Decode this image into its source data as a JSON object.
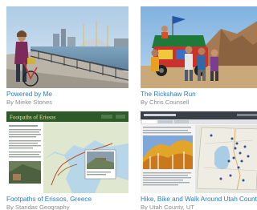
{
  "gallery": {
    "items": [
      {
        "title": "Powered by Me",
        "author": "By Mieke Stones",
        "thumbnail": "photo of a woman with bicycle on a waterfront promenade, city skyline behind"
      },
      {
        "title": "The Rickshaw Run",
        "author": "By Chris Counsell",
        "thumbnail": "photo of travelers posing with a decorated rickshaw in a desert"
      },
      {
        "title": "Footpaths of Erissos, Greece",
        "author": "By Staridas Geography",
        "thumbnail": "story map screenshot with green header, text panel and coastal map",
        "map_header": "Footpaths of Erissos"
      },
      {
        "title": "Hike, Bike and Walk Around Utah County",
        "author": "By Utah County, UT",
        "thumbnail": "story map screenshot with autumn aspen photo and county map"
      }
    ]
  },
  "colors": {
    "title_link": "#2a7bc0",
    "author_text": "#8c8c8c",
    "map_header_green": "#2e5a2a"
  }
}
